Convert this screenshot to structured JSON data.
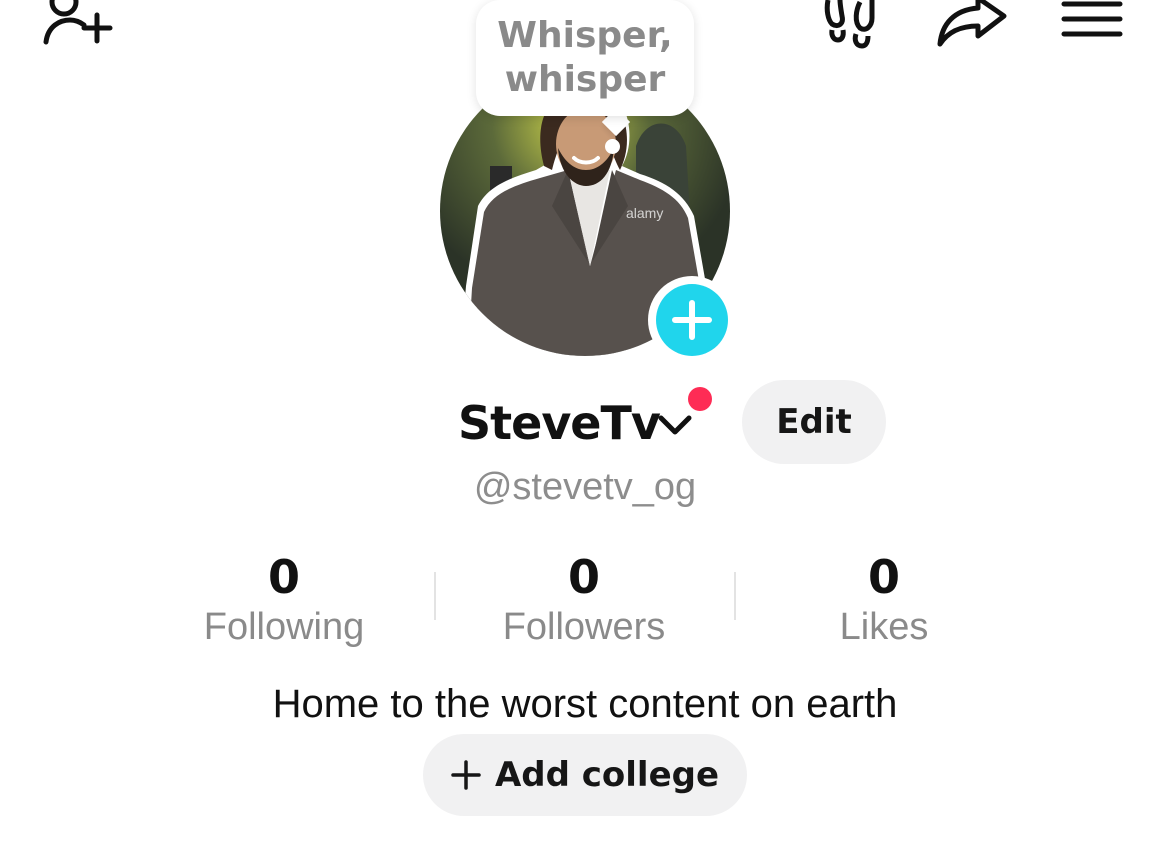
{
  "icons": {
    "add_friend": "add-person-icon",
    "footprints": "footprints-icon",
    "share": "share-arrow-icon",
    "menu": "hamburger-menu-icon",
    "add_photo": "plus-icon",
    "name_dropdown": "chevron-down-icon"
  },
  "bubble": {
    "text": "Whisper,\nwhisper"
  },
  "avatar": {
    "watermark": "alamy"
  },
  "profile": {
    "display_name": "SteveTv",
    "username": "@stevetv_og",
    "edit_label": "Edit",
    "bio": "Home to the worst content on earth"
  },
  "stats": [
    {
      "value": "0",
      "label": "Following"
    },
    {
      "value": "0",
      "label": "Followers"
    },
    {
      "value": "0",
      "label": "Likes"
    }
  ],
  "add_college": {
    "label": "Add college"
  },
  "colors": {
    "accent_cyan": "#20d5ec",
    "notification_red": "#fe2c55",
    "button_bg": "#f1f1f2",
    "secondary_text": "#8a8a8a"
  }
}
